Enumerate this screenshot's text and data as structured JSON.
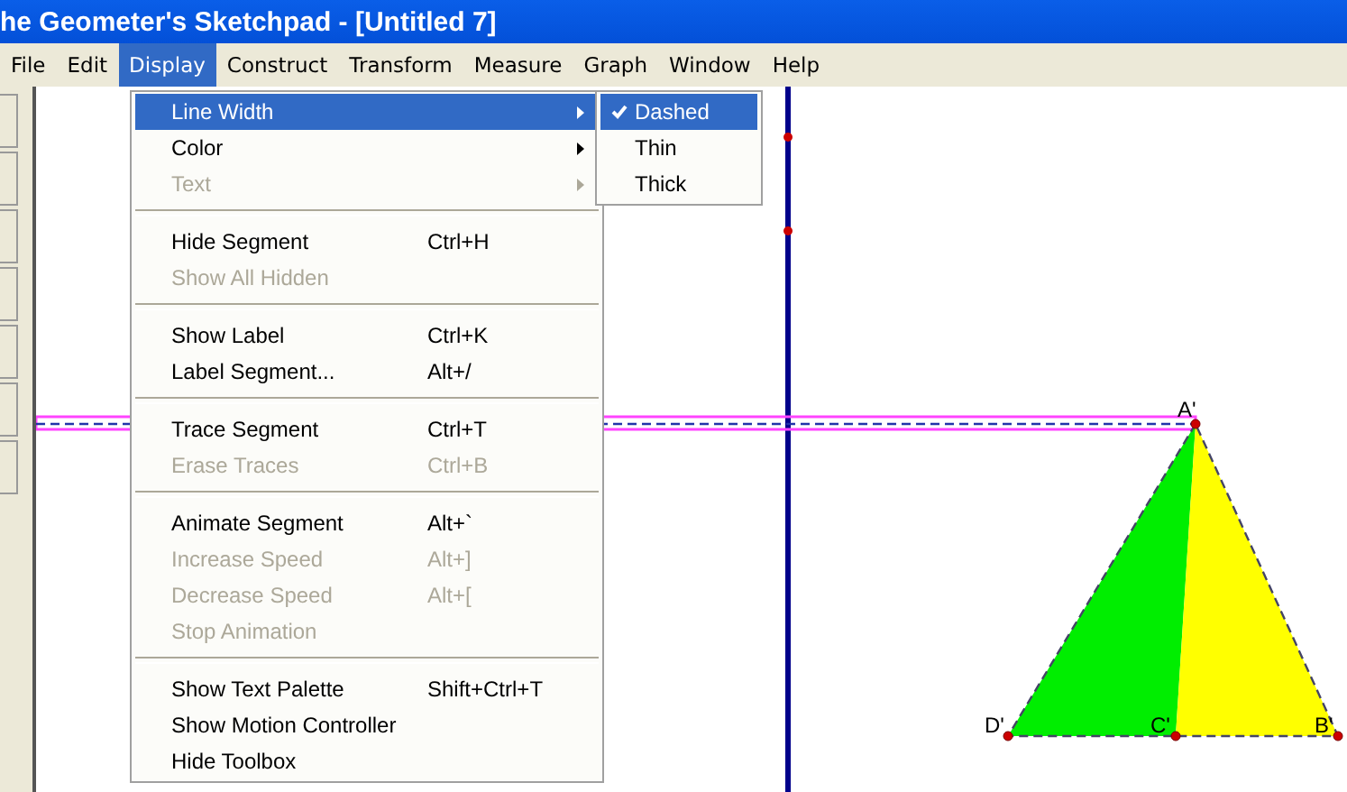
{
  "window": {
    "title": "he Geometer's Sketchpad - [Untitled 7]"
  },
  "menu_bar": [
    {
      "label": "File",
      "selected": false
    },
    {
      "label": "Edit",
      "selected": false
    },
    {
      "label": "Display",
      "selected": true
    },
    {
      "label": "Construct",
      "selected": false
    },
    {
      "label": "Transform",
      "selected": false
    },
    {
      "label": "Measure",
      "selected": false
    },
    {
      "label": "Graph",
      "selected": false
    },
    {
      "label": "Window",
      "selected": false
    },
    {
      "label": "Help",
      "selected": false
    }
  ],
  "display_menu": [
    [
      {
        "label": "Line Width",
        "submenu": true,
        "disabled": false,
        "selected": true
      },
      {
        "label": "Color",
        "submenu": true,
        "disabled": false,
        "selected": false
      },
      {
        "label": "Text",
        "submenu": true,
        "disabled": true,
        "selected": false
      }
    ],
    [
      {
        "label": "Hide Segment",
        "shortcut": "Ctrl+H",
        "disabled": false,
        "selected": false
      },
      {
        "label": "Show All Hidden",
        "disabled": true,
        "selected": false
      }
    ],
    [
      {
        "label": "Show Label",
        "shortcut": "Ctrl+K",
        "disabled": false,
        "selected": false
      },
      {
        "label": "Label Segment...",
        "shortcut": "Alt+/",
        "disabled": false,
        "selected": false
      }
    ],
    [
      {
        "label": "Trace Segment",
        "shortcut": "Ctrl+T",
        "disabled": false,
        "selected": false
      },
      {
        "label": "Erase Traces",
        "shortcut": "Ctrl+B",
        "disabled": true,
        "selected": false
      }
    ],
    [
      {
        "label": "Animate Segment",
        "shortcut": "Alt+`",
        "disabled": false,
        "selected": false
      },
      {
        "label": "Increase Speed",
        "shortcut": "Alt+]",
        "disabled": true,
        "selected": false
      },
      {
        "label": "Decrease Speed",
        "shortcut": "Alt+[",
        "disabled": true,
        "selected": false
      },
      {
        "label": "Stop Animation",
        "disabled": true,
        "selected": false
      }
    ],
    [
      {
        "label": "Show Text Palette",
        "shortcut": "Shift+Ctrl+T",
        "disabled": false,
        "selected": false
      },
      {
        "label": "Show Motion Controller",
        "disabled": false,
        "selected": false
      },
      {
        "label": "Hide Toolbox",
        "disabled": false,
        "selected": false
      }
    ]
  ],
  "line_width_submenu": [
    {
      "label": "Dashed",
      "checked": true,
      "selected": true
    },
    {
      "label": "Thin",
      "checked": false,
      "selected": false
    },
    {
      "label": "Thick",
      "checked": false,
      "selected": false
    }
  ],
  "canvas": {
    "point_labels": [
      "A'",
      "D'",
      "C'",
      "B'"
    ]
  }
}
